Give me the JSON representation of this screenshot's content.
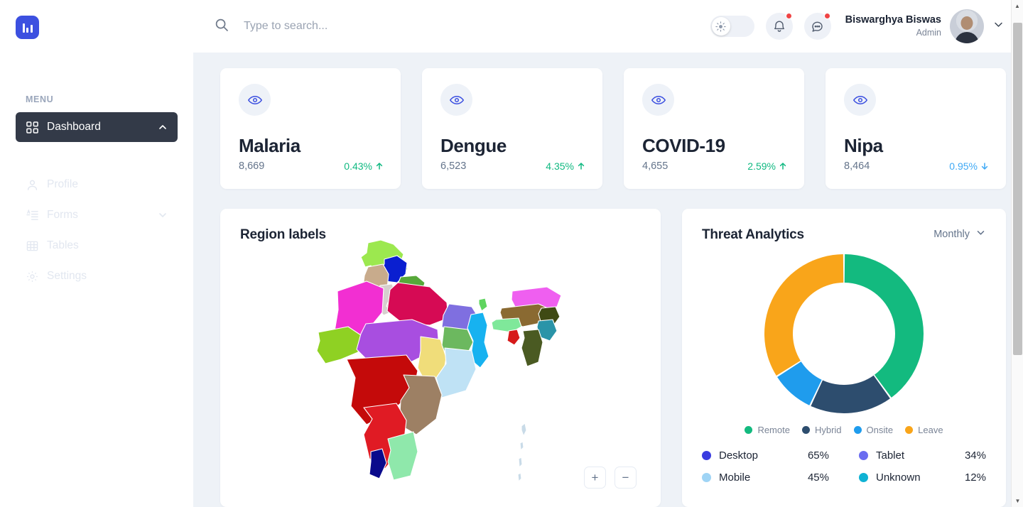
{
  "sidebar": {
    "logo_name": "bar-chart-logo",
    "menu_label": "MENU",
    "items": [
      {
        "label": "Dashboard",
        "icon": "grid-icon",
        "active": true,
        "chevron": "chevron-up-icon"
      },
      {
        "label": "Profile",
        "icon": "user-icon",
        "active": false,
        "chevron": ""
      },
      {
        "label": "Forms",
        "icon": "form-icon",
        "active": false,
        "chevron": "chevron-down-icon"
      },
      {
        "label": "Tables",
        "icon": "table-icon",
        "active": false,
        "chevron": ""
      },
      {
        "label": "Settings",
        "icon": "gear-icon",
        "active": false,
        "chevron": ""
      }
    ]
  },
  "topbar": {
    "search_placeholder": "Type to search...",
    "search_value": "",
    "theme_toggle": {
      "icon": "sun-icon",
      "state": "light"
    },
    "notification_icon": "bell-icon",
    "messages_icon": "chat-icon",
    "user": {
      "name": "Biswarghya Biswas",
      "role": "Admin"
    },
    "user_menu_icon": "chevron-down-icon"
  },
  "stat_cards": [
    {
      "title": "Malaria",
      "value": "8,669",
      "delta": "0.43%",
      "direction": "up",
      "color": "#10b981",
      "icon": "eye-icon"
    },
    {
      "title": "Dengue",
      "value": "6,523",
      "delta": "4.35%",
      "direction": "up",
      "color": "#10b981",
      "icon": "eye-icon"
    },
    {
      "title": "COVID-19",
      "value": "4,655",
      "delta": "2.59%",
      "direction": "up",
      "color": "#10b981",
      "icon": "eye-icon"
    },
    {
      "title": "Nipa",
      "value": "8,464",
      "delta": "0.95%",
      "direction": "down",
      "color": "#3fa9f5",
      "icon": "eye-icon"
    }
  ],
  "map_panel": {
    "title": "Region labels",
    "zoom_in_label": "+",
    "zoom_out_label": "−",
    "map_name": "india-regions-map"
  },
  "chart_panel": {
    "title": "Threat Analytics",
    "period": "Monthly",
    "period_icon": "chevron-down-icon"
  },
  "chart_data": {
    "type": "pie",
    "title": "Threat Analytics",
    "subtitle": "Monthly",
    "variant": "donut",
    "legend_position": "bottom",
    "categories": [
      "Remote",
      "Hybrid",
      "Onsite",
      "Leave"
    ],
    "values": [
      40,
      17,
      9,
      34
    ],
    "colors": [
      "#13ba7f",
      "#2d4d6e",
      "#1f9ced",
      "#f9a51a"
    ],
    "start_angle": 0,
    "devices": [
      {
        "label": "Desktop",
        "value": "65%",
        "color": "#3a3ce0"
      },
      {
        "label": "Tablet",
        "value": "34%",
        "color": "#6a6cf0"
      },
      {
        "label": "Mobile",
        "value": "45%",
        "color": "#9fd4f5"
      },
      {
        "label": "Unknown",
        "value": "12%",
        "color": "#0fb2d4"
      }
    ]
  }
}
